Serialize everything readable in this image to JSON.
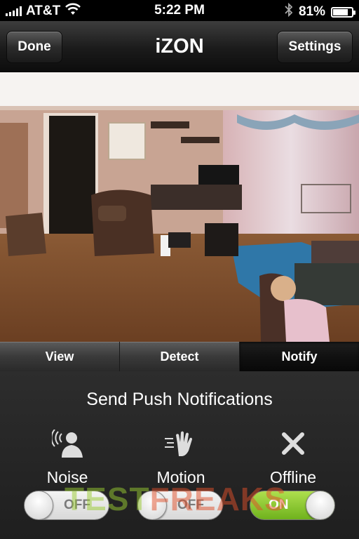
{
  "status_bar": {
    "carrier": "AT&T",
    "time": "5:22 PM",
    "battery": "81%",
    "battery_level": 0.81,
    "icons": [
      "signal-icon",
      "wifi-icon",
      "bluetooth-icon",
      "battery-icon"
    ]
  },
  "nav": {
    "title": "iZON",
    "done_label": "Done",
    "settings_label": "Settings"
  },
  "camera": {
    "icon": "camera-feed-image"
  },
  "tabs": [
    {
      "label": "View",
      "active": false
    },
    {
      "label": "Detect",
      "active": false
    },
    {
      "label": "Notify",
      "active": true
    }
  ],
  "panel": {
    "title": "Send Push Notifications",
    "options": [
      {
        "label": "Noise",
        "icon": "noise-icon",
        "state": "OFF"
      },
      {
        "label": "Motion",
        "icon": "motion-icon",
        "state": "OFF"
      },
      {
        "label": "Offline",
        "icon": "close-icon",
        "state": "ON"
      }
    ]
  },
  "watermark": {
    "part1": "TEST",
    "part2": "FREAKS"
  },
  "colors": {
    "toggle_on": "#7bbf26",
    "toggle_off": "#e6e6e6",
    "nav_bg": "#1b1b1b"
  }
}
